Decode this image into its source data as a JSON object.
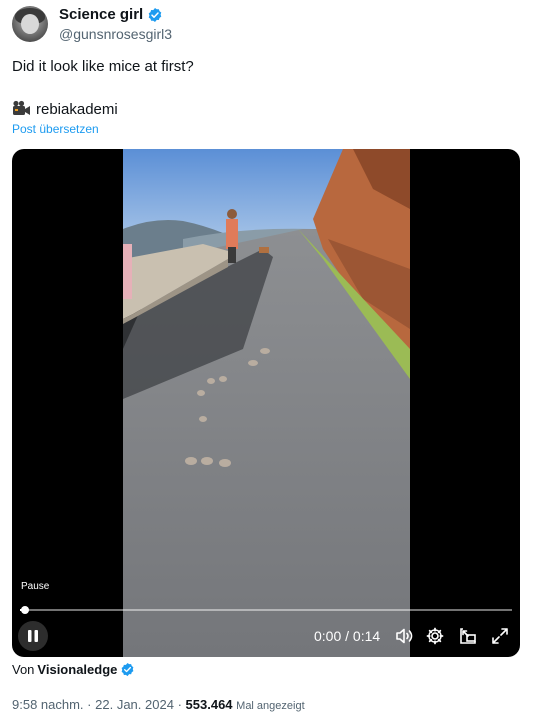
{
  "author": {
    "display_name": "Science girl",
    "handle": "@gunsnrosesgirl3"
  },
  "tweet": {
    "text": "Did it look like mice at first?",
    "source_name": "rebiakademi",
    "translate_label": "Post übersetzen"
  },
  "video": {
    "status_tip": "Pause",
    "time_display": "0:00 / 0:14",
    "progress": 0.01
  },
  "attribution": {
    "prefix": "Von",
    "name": "Visionaledge"
  },
  "meta": {
    "time": "9:58 nachm.",
    "separator1": "·",
    "date": "22. Jan. 2024",
    "separator2": "·",
    "views": "553.464",
    "views_label": "Mal angezeigt"
  },
  "colors": {
    "accent": "#1d9bf0",
    "secondary_text": "#536471"
  }
}
